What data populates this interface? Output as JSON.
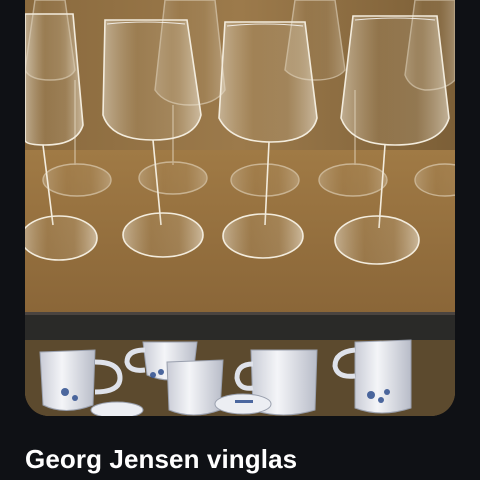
{
  "listing": {
    "title": "Georg Jensen vinglas"
  }
}
